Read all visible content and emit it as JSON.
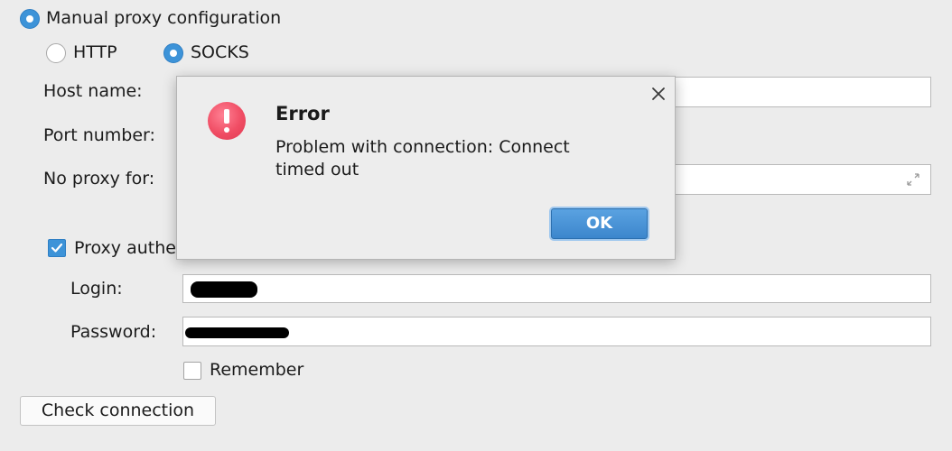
{
  "proxy": {
    "manual_label": "Manual proxy configuration",
    "http_label": "HTTP",
    "socks_label": "SOCKS",
    "host_label": "Host name:",
    "port_label": "Port number:",
    "no_proxy_label": "No proxy for:",
    "auth_label": "Proxy authe",
    "login_label": "Login:",
    "password_label": "Password:",
    "remember_label": "Remember",
    "check_button": "Check connection"
  },
  "dialog": {
    "title": "Error",
    "message_line1": "Problem with connection: Connect",
    "message_line2": "timed out",
    "ok_label": "OK"
  }
}
